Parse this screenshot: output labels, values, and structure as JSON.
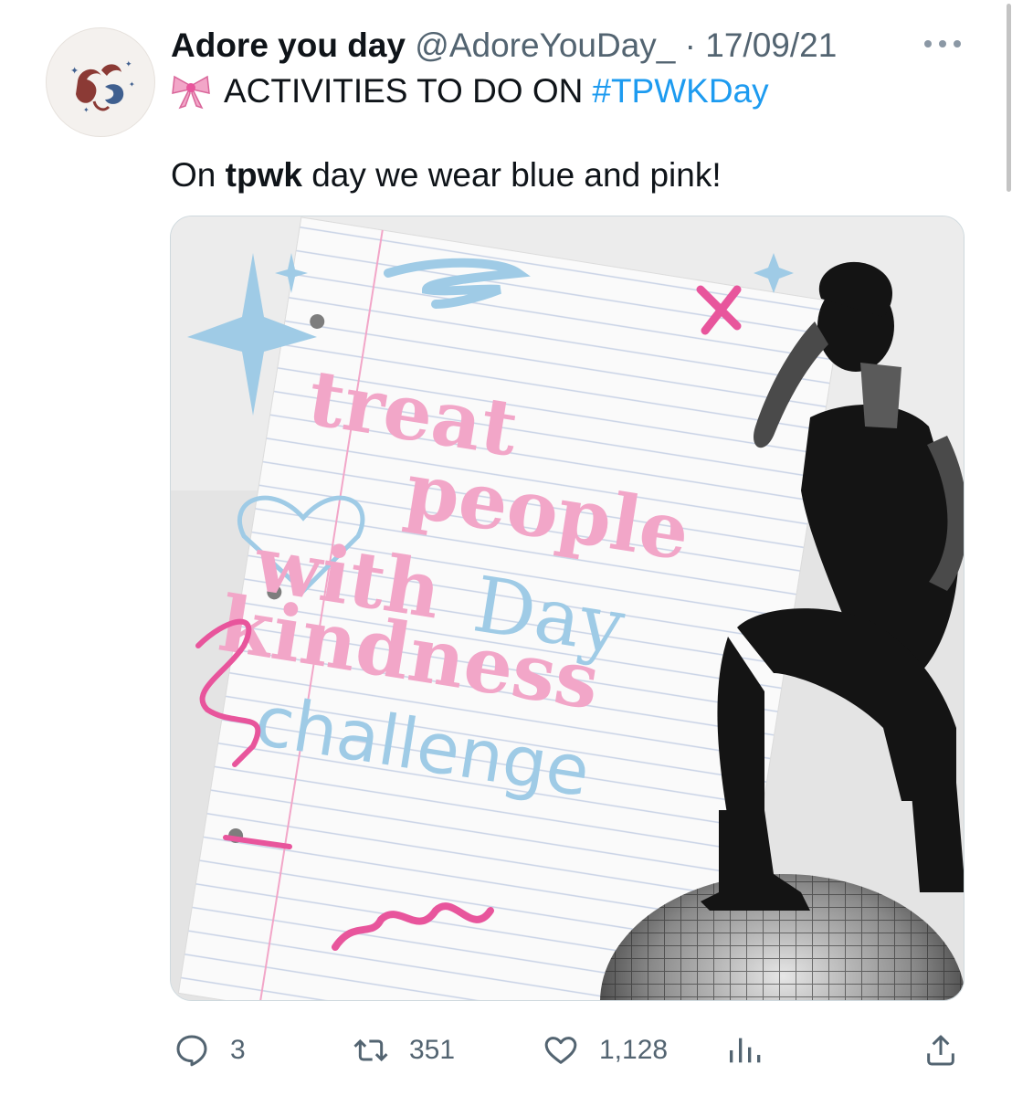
{
  "tweet": {
    "display_name": "Adore you day",
    "handle": "@AdoreYouDay_",
    "separator": "·",
    "date": "17/09/21",
    "text_line1": "ACTIVITIES TO DO ON",
    "hashtag": "#TPWKDay",
    "line2_pre": "On",
    "line2_bold": "tpwk",
    "line2_post": "day we wear blue and pink!"
  },
  "media": {
    "words": [
      "treat",
      "people",
      "with",
      "Day",
      "kindness",
      "challenge"
    ],
    "colors": {
      "pink": "#f2a6c8",
      "blue": "#9fcbe6",
      "hot_pink": "#e8559c"
    }
  },
  "actions": {
    "reply_count": "3",
    "retweet_count": "351",
    "like_count": "1,128"
  },
  "icons": [
    "bow-icon",
    "more-icon",
    "reply-icon",
    "retweet-icon",
    "like-icon",
    "analytics-icon",
    "share-icon"
  ],
  "colors": {
    "link": "#1d9bf0",
    "muted": "#536471",
    "text": "#0f1419"
  }
}
